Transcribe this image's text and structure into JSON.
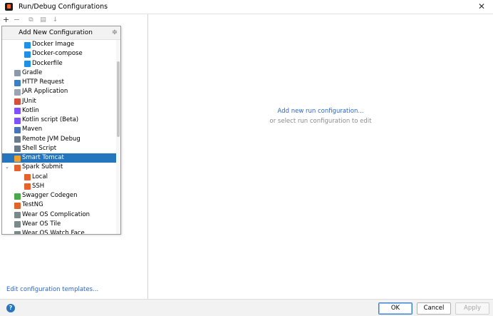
{
  "window": {
    "title": "Run/Debug Configurations",
    "close_glyph": "✕"
  },
  "toolbar": {
    "add_glyph": "+",
    "remove_glyph": "−",
    "copy_glyph": "⧉",
    "folder_glyph": "▤",
    "sort_glyph": "↓"
  },
  "popup": {
    "header_title": "Add New Configuration",
    "collapse_glyph": "≑",
    "items": [
      {
        "label": "Docker Image",
        "icon": "docker-icon",
        "color": "#1d91e8"
      },
      {
        "label": "Docker-compose",
        "icon": "docker-icon",
        "color": "#1d91e8"
      },
      {
        "label": "Dockerfile",
        "icon": "docker-icon",
        "color": "#1d91e8"
      },
      {
        "label": "Gradle",
        "icon": "gradle-icon",
        "color": "#8a9aa8"
      },
      {
        "label": "HTTP Request",
        "icon": "http-request-icon",
        "color": "#3e7fc1"
      },
      {
        "label": "JAR Application",
        "icon": "jar-icon",
        "color": "#9aa5b1"
      },
      {
        "label": "JUnit",
        "icon": "junit-icon",
        "color": "#d64f3c"
      },
      {
        "label": "Kotlin",
        "icon": "kotlin-icon",
        "color": "#7f52ff"
      },
      {
        "label": "Kotlin script (Beta)",
        "icon": "kotlin-script-icon",
        "color": "#7f52ff"
      },
      {
        "label": "Maven",
        "icon": "maven-icon",
        "color": "#4a74b9"
      },
      {
        "label": "Remote JVM Debug",
        "icon": "remote-debug-icon",
        "color": "#6b7b8a"
      },
      {
        "label": "Shell Script",
        "icon": "shell-script-icon",
        "color": "#6b7b8a"
      },
      {
        "label": "Smart Tomcat",
        "icon": "tomcat-icon",
        "color": "#f0a030"
      },
      {
        "label": "Spark Submit",
        "icon": "spark-icon",
        "color": "#e8602c"
      },
      {
        "label": "Local",
        "icon": "spark-icon",
        "color": "#e8602c"
      },
      {
        "label": "SSH",
        "icon": "spark-icon",
        "color": "#e8602c"
      },
      {
        "label": "Swagger Codegen",
        "icon": "swagger-icon",
        "color": "#4aa84a"
      },
      {
        "label": "TestNG",
        "icon": "testng-icon",
        "color": "#e0652b"
      },
      {
        "label": "Wear OS Complication",
        "icon": "wear-os-icon",
        "color": "#7a8a8a"
      },
      {
        "label": "Wear OS Tile",
        "icon": "wear-os-icon",
        "color": "#7a8a8a"
      },
      {
        "label": "Wear OS Watch Face",
        "icon": "wear-os-icon",
        "color": "#7a8a8a"
      }
    ],
    "selected_label": "Smart Tomcat",
    "expander_glyph": "⌄"
  },
  "left": {
    "edit_templates_link": "Edit configuration templates..."
  },
  "right": {
    "add_new_link": "Add new run configuration...",
    "hint": "or select run configuration to edit"
  },
  "footer": {
    "help_glyph": "?",
    "ok_label": "OK",
    "cancel_label": "Cancel",
    "apply_label": "Apply"
  },
  "colors": {
    "selection": "#2675bf",
    "link": "#2f65ca"
  }
}
